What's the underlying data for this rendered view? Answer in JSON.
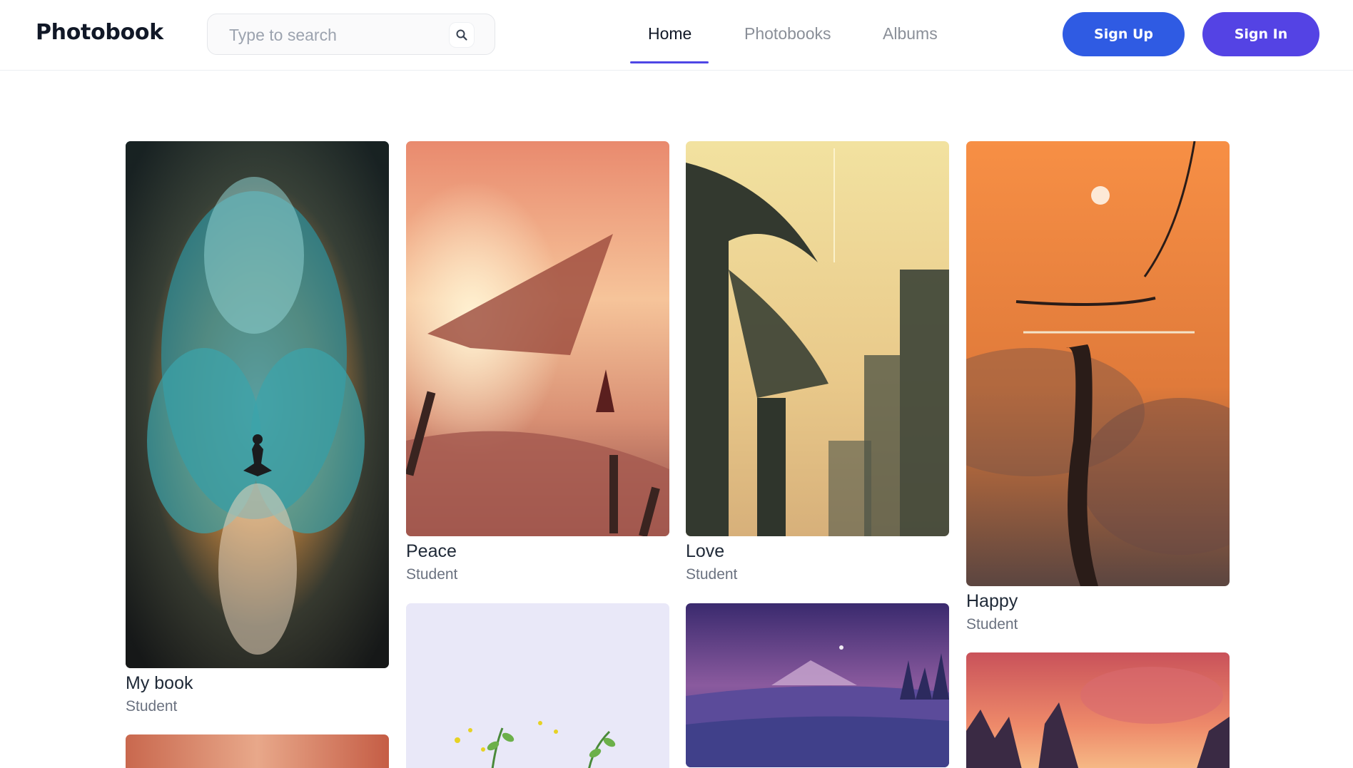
{
  "header": {
    "logo": "Photobook",
    "search_placeholder": "Type to search",
    "nav": {
      "home": "Home",
      "photobooks": "Photobooks",
      "albums": "Albums"
    },
    "signup_label": "Sign Up",
    "signin_label": "Sign In",
    "colors": {
      "active_underline": "#4f46e5",
      "signup": "#2f5be3",
      "signin": "#5443e4"
    }
  },
  "cards": [
    {
      "title": "My book",
      "author": "Student"
    },
    {
      "title": "Peace",
      "author": "Student"
    },
    {
      "title": "Love",
      "author": "Student"
    },
    {
      "title": "Happy",
      "author": "Student"
    }
  ]
}
